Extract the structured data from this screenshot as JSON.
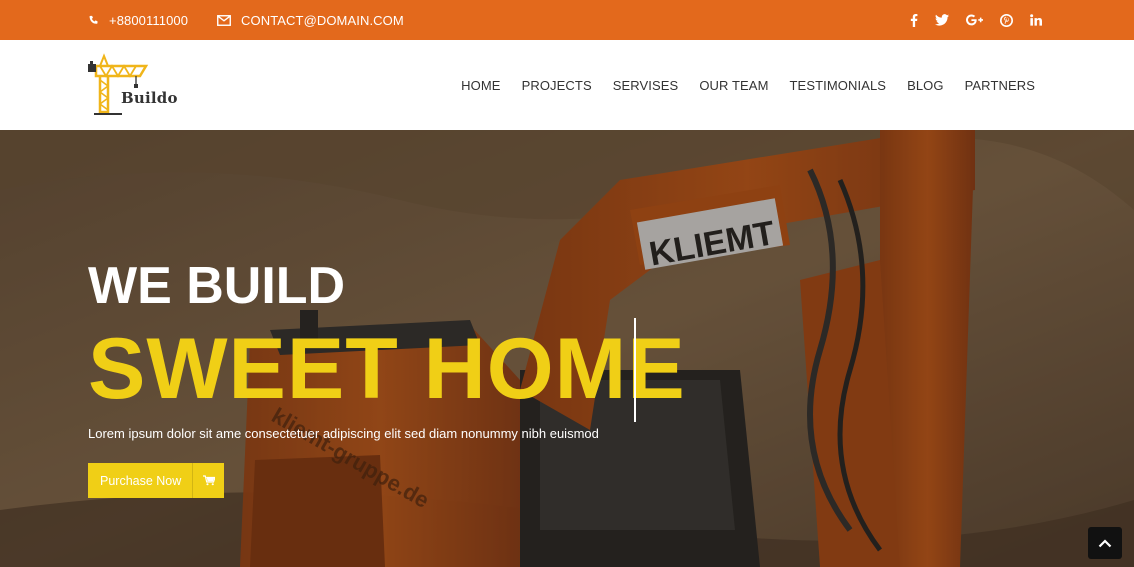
{
  "topbar": {
    "phone": "+8800111000",
    "email": "CONTACT@DOMAIN.COM",
    "socials": [
      "facebook-icon",
      "twitter-icon",
      "google-plus-icon",
      "pinterest-icon",
      "linkedin-icon"
    ]
  },
  "header": {
    "logo_text": "Buildo",
    "nav": [
      {
        "label": "HOME"
      },
      {
        "label": "PROJECTS"
      },
      {
        "label": "SERVISES"
      },
      {
        "label": "OUR TEAM"
      },
      {
        "label": "TESTIMONIALS"
      },
      {
        "label": "BLOG"
      },
      {
        "label": "PARTNERS"
      }
    ]
  },
  "hero": {
    "title_line1": "WE BUILD",
    "title_line2": "SWEET HOME",
    "subtitle": "Lorem ipsum dolor sit ame consectetuer adipiscing elit sed diam nonummy nibh euismod",
    "button_label": "Purchase Now",
    "machine_label": "KLIEMT",
    "machine_side_text": "kliemt-gruppe.de"
  },
  "colors": {
    "accent_orange": "#e3691c",
    "accent_yellow": "#f0cf16",
    "excavator": "#d8611b"
  }
}
